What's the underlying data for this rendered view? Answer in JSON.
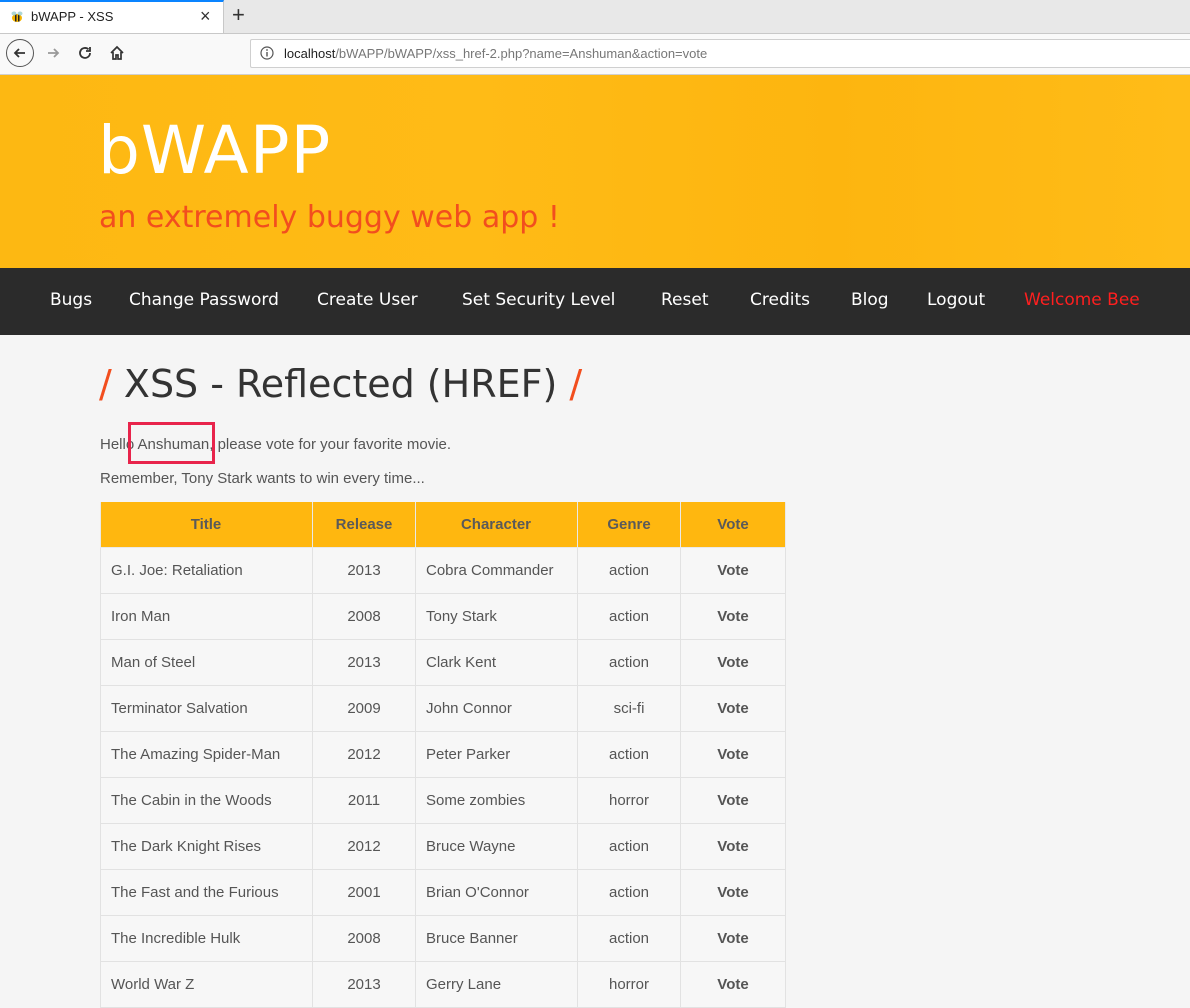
{
  "browser": {
    "tab_title": "bWAPP - XSS",
    "close_tab": "×",
    "new_tab": "+",
    "url_host": "localhost",
    "url_path": "/bWAPP/bWAPP/xss_href-2.php?name=Anshuman&action=vote"
  },
  "header": {
    "logo": "bWAPP",
    "tagline": "an extremely buggy web app !"
  },
  "menu": {
    "items": [
      "Bugs",
      "Change Password",
      "Create User",
      "Set Security Level",
      "Reset",
      "Credits",
      "Blog",
      "Logout"
    ],
    "welcome": "Welcome Bee"
  },
  "content": {
    "slash_left": "/",
    "title": "XSS - Reflected (HREF)",
    "slash_right": "/",
    "hello_prefix": "Hello ",
    "name": "Anshuman",
    "hello_suffix": ", please vote for your favorite movie.",
    "remember": "Remember, Tony Stark wants to win every time..."
  },
  "table": {
    "headers": [
      "Title",
      "Release",
      "Character",
      "Genre",
      "Vote"
    ],
    "rows": [
      [
        "G.I. Joe: Retaliation",
        "2013",
        "Cobra Commander",
        "action",
        "Vote"
      ],
      [
        "Iron Man",
        "2008",
        "Tony Stark",
        "action",
        "Vote"
      ],
      [
        "Man of Steel",
        "2013",
        "Clark Kent",
        "action",
        "Vote"
      ],
      [
        "Terminator Salvation",
        "2009",
        "John Connor",
        "sci-fi",
        "Vote"
      ],
      [
        "The Amazing Spider-Man",
        "2012",
        "Peter Parker",
        "action",
        "Vote"
      ],
      [
        "The Cabin in the Woods",
        "2011",
        "Some zombies",
        "horror",
        "Vote"
      ],
      [
        "The Dark Knight Rises",
        "2012",
        "Bruce Wayne",
        "action",
        "Vote"
      ],
      [
        "The Fast and the Furious",
        "2001",
        "Brian O'Connor",
        "action",
        "Vote"
      ],
      [
        "The Incredible Hulk",
        "2008",
        "Bruce Banner",
        "action",
        "Vote"
      ],
      [
        "World War Z",
        "2013",
        "Gerry Lane",
        "horror",
        "Vote"
      ]
    ]
  },
  "colors": {
    "header_bg": "#ffb70f",
    "menu_bg": "#2b2b2b",
    "accent": "#f24e1e",
    "welcome": "#ff1f1f",
    "highlight_box": "#e8244b"
  },
  "icons": {
    "favicon": "bee-icon",
    "back": "back-arrow-icon",
    "forward": "forward-arrow-icon",
    "reload": "reload-icon",
    "home": "home-icon",
    "site_info": "info-icon"
  }
}
